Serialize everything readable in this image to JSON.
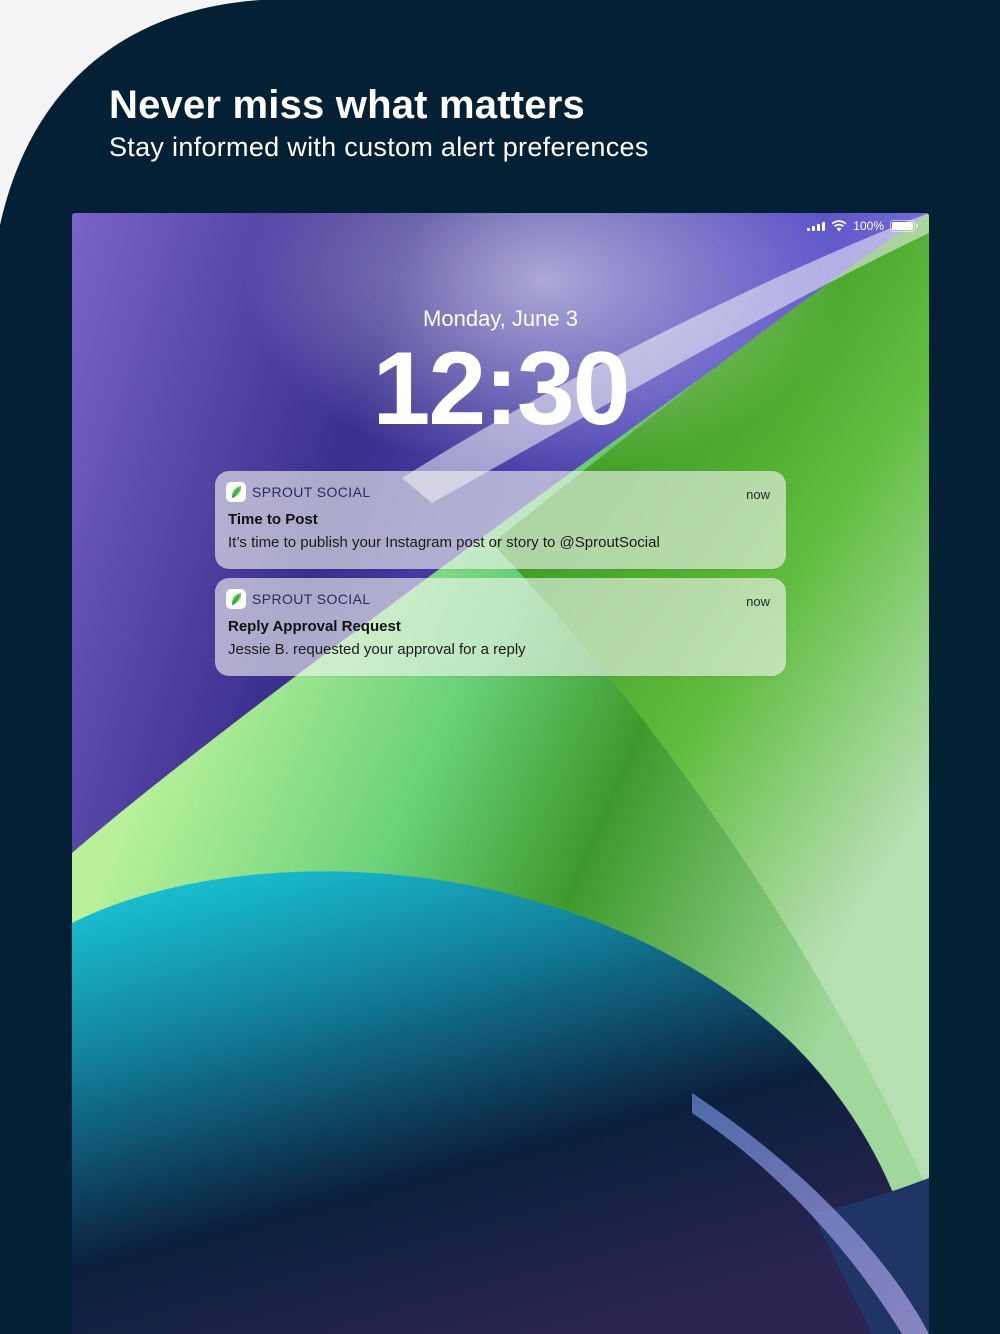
{
  "marketing": {
    "headline": "Never miss what matters",
    "subheadline": "Stay informed with custom alert preferences"
  },
  "status_bar": {
    "battery": "100%"
  },
  "lock_screen": {
    "date": "Monday, June 3",
    "time": "12:30"
  },
  "notifications": [
    {
      "app": "SPROUT SOCIAL",
      "time": "now",
      "title": "Time to Post",
      "body": "It’s time to publish your Instagram post or story to @SproutSocial"
    },
    {
      "app": "SPROUT SOCIAL",
      "time": "now",
      "title": "Reply Approval Request",
      "body": "Jessie B. requested your approval for a reply"
    }
  ],
  "colors": {
    "navy": "#042035",
    "page_light": "#f3f4f3",
    "sprout_green": "#59cb59"
  },
  "icons": [
    "signal-icon",
    "wifi-icon",
    "battery-icon",
    "sprout-leaf-icon"
  ]
}
